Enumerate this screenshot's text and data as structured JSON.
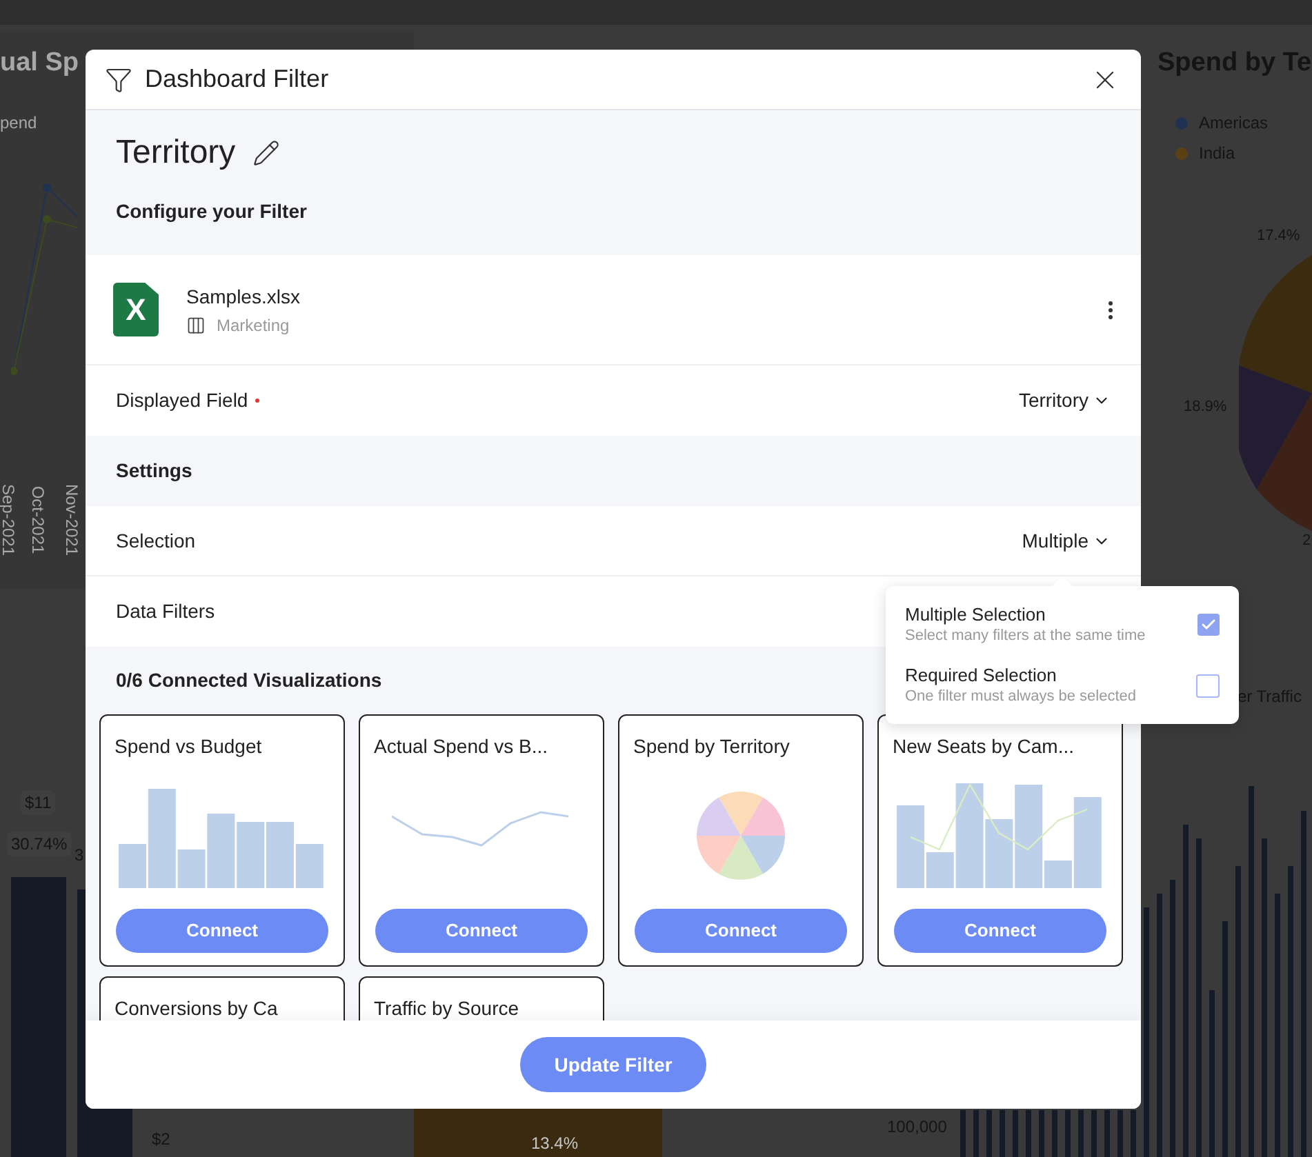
{
  "background": {
    "left_chart": {
      "title": "ual Sp",
      "legend": "pend",
      "x_labels": [
        "Sep-2021",
        "Oct-2021",
        "Nov-2021"
      ]
    },
    "right_chart": {
      "title": "Spend by Te",
      "legend": [
        {
          "label": "Americas",
          "color": "#1f3252"
        },
        {
          "label": "India",
          "color": "#5c3f12"
        }
      ],
      "labels": [
        "17.4%",
        "18.9%",
        "2"
      ]
    },
    "bottom_left": {
      "labels": [
        "$11",
        "30.74%",
        "3"
      ],
      "axis": "$2"
    },
    "bottom_middle": {
      "label": "13.4%"
    },
    "bottom_right": {
      "title": "er Traffic",
      "axis": "100,000"
    }
  },
  "dialog": {
    "title": "Dashboard Filter",
    "filter_name": "Territory",
    "configure_heading": "Configure your Filter",
    "source": {
      "logo_letter": "X",
      "file": "Samples.xlsx",
      "sheet": "Marketing"
    },
    "displayed_field": {
      "label": "Displayed Field",
      "required": true,
      "value": "Territory"
    },
    "settings_heading": "Settings",
    "selection": {
      "label": "Selection",
      "value": "Multiple",
      "expanded": true
    },
    "data_filters": {
      "label": "Data Filters"
    },
    "connected_heading": "0/6 Connected Visualizations",
    "visualizations": [
      {
        "title": "Spend vs Budget",
        "kind": "bar",
        "button": "Connect"
      },
      {
        "title": "Actual Spend vs B...",
        "kind": "line",
        "button": "Connect"
      },
      {
        "title": "Spend by Territory",
        "kind": "pie",
        "button": "Connect"
      },
      {
        "title": "New Seats by Cam...",
        "kind": "combo",
        "button": "Connect"
      },
      {
        "title": "Conversions by Ca",
        "kind": "none"
      },
      {
        "title": "Traffic by Source",
        "kind": "none"
      }
    ],
    "update_button": "Update Filter"
  },
  "selection_menu": [
    {
      "title": "Multiple Selection",
      "description": "Select many filters at the same time",
      "checked": true
    },
    {
      "title": "Required Selection",
      "description": "One filter must always be selected",
      "checked": false
    }
  ]
}
